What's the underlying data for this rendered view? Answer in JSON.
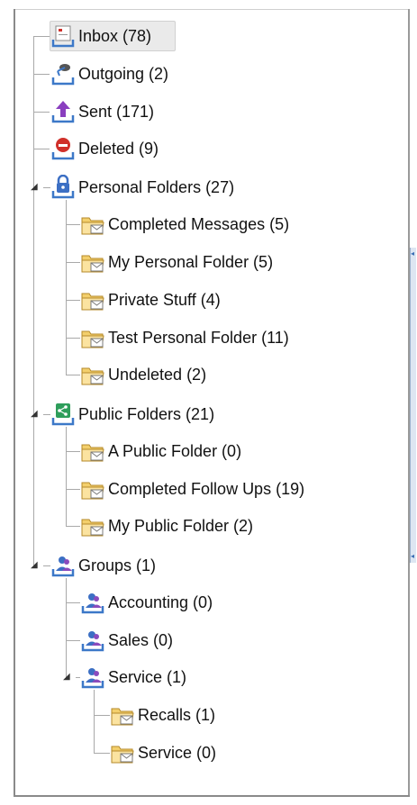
{
  "tree": {
    "inbox": {
      "label": "Inbox (78)"
    },
    "outgoing": {
      "label": "Outgoing (2)"
    },
    "sent": {
      "label": "Sent (171)"
    },
    "deleted": {
      "label": "Deleted (9)"
    },
    "personal": {
      "label": "Personal Folders (27)",
      "children": [
        {
          "label": "Completed Messages (5)"
        },
        {
          "label": "My Personal Folder (5)"
        },
        {
          "label": "Private Stuff (4)"
        },
        {
          "label": "Test Personal Folder (11)"
        },
        {
          "label": "Undeleted (2)"
        }
      ]
    },
    "public": {
      "label": "Public Folders (21)",
      "children": [
        {
          "label": "A Public Folder (0)"
        },
        {
          "label": "Completed Follow Ups (19)"
        },
        {
          "label": "My Public Folder (2)"
        }
      ]
    },
    "groups": {
      "label": "Groups (1)",
      "children": [
        {
          "label": "Accounting (0)"
        },
        {
          "label": "Sales (0)"
        },
        {
          "label": "Service (1)",
          "children": [
            {
              "label": "Recalls (1)"
            },
            {
              "label": "Service (0)"
            }
          ]
        }
      ]
    }
  },
  "colors": {
    "folder": "#f5d57a",
    "tray": "#3c78c8",
    "sent_arrow": "#8a3fbf",
    "deleted_red": "#d0302a",
    "public_green": "#2e9e5b",
    "group_purple": "#7a3fb8"
  },
  "icons": {
    "inbox": "inbox-icon",
    "outgoing": "outgoing-icon",
    "sent": "sent-icon",
    "deleted": "deleted-icon",
    "personal": "lock-icon",
    "public": "share-icon",
    "groups": "group-icon",
    "folder": "folder-mail-icon",
    "expander": "expanded-triangle-icon"
  }
}
